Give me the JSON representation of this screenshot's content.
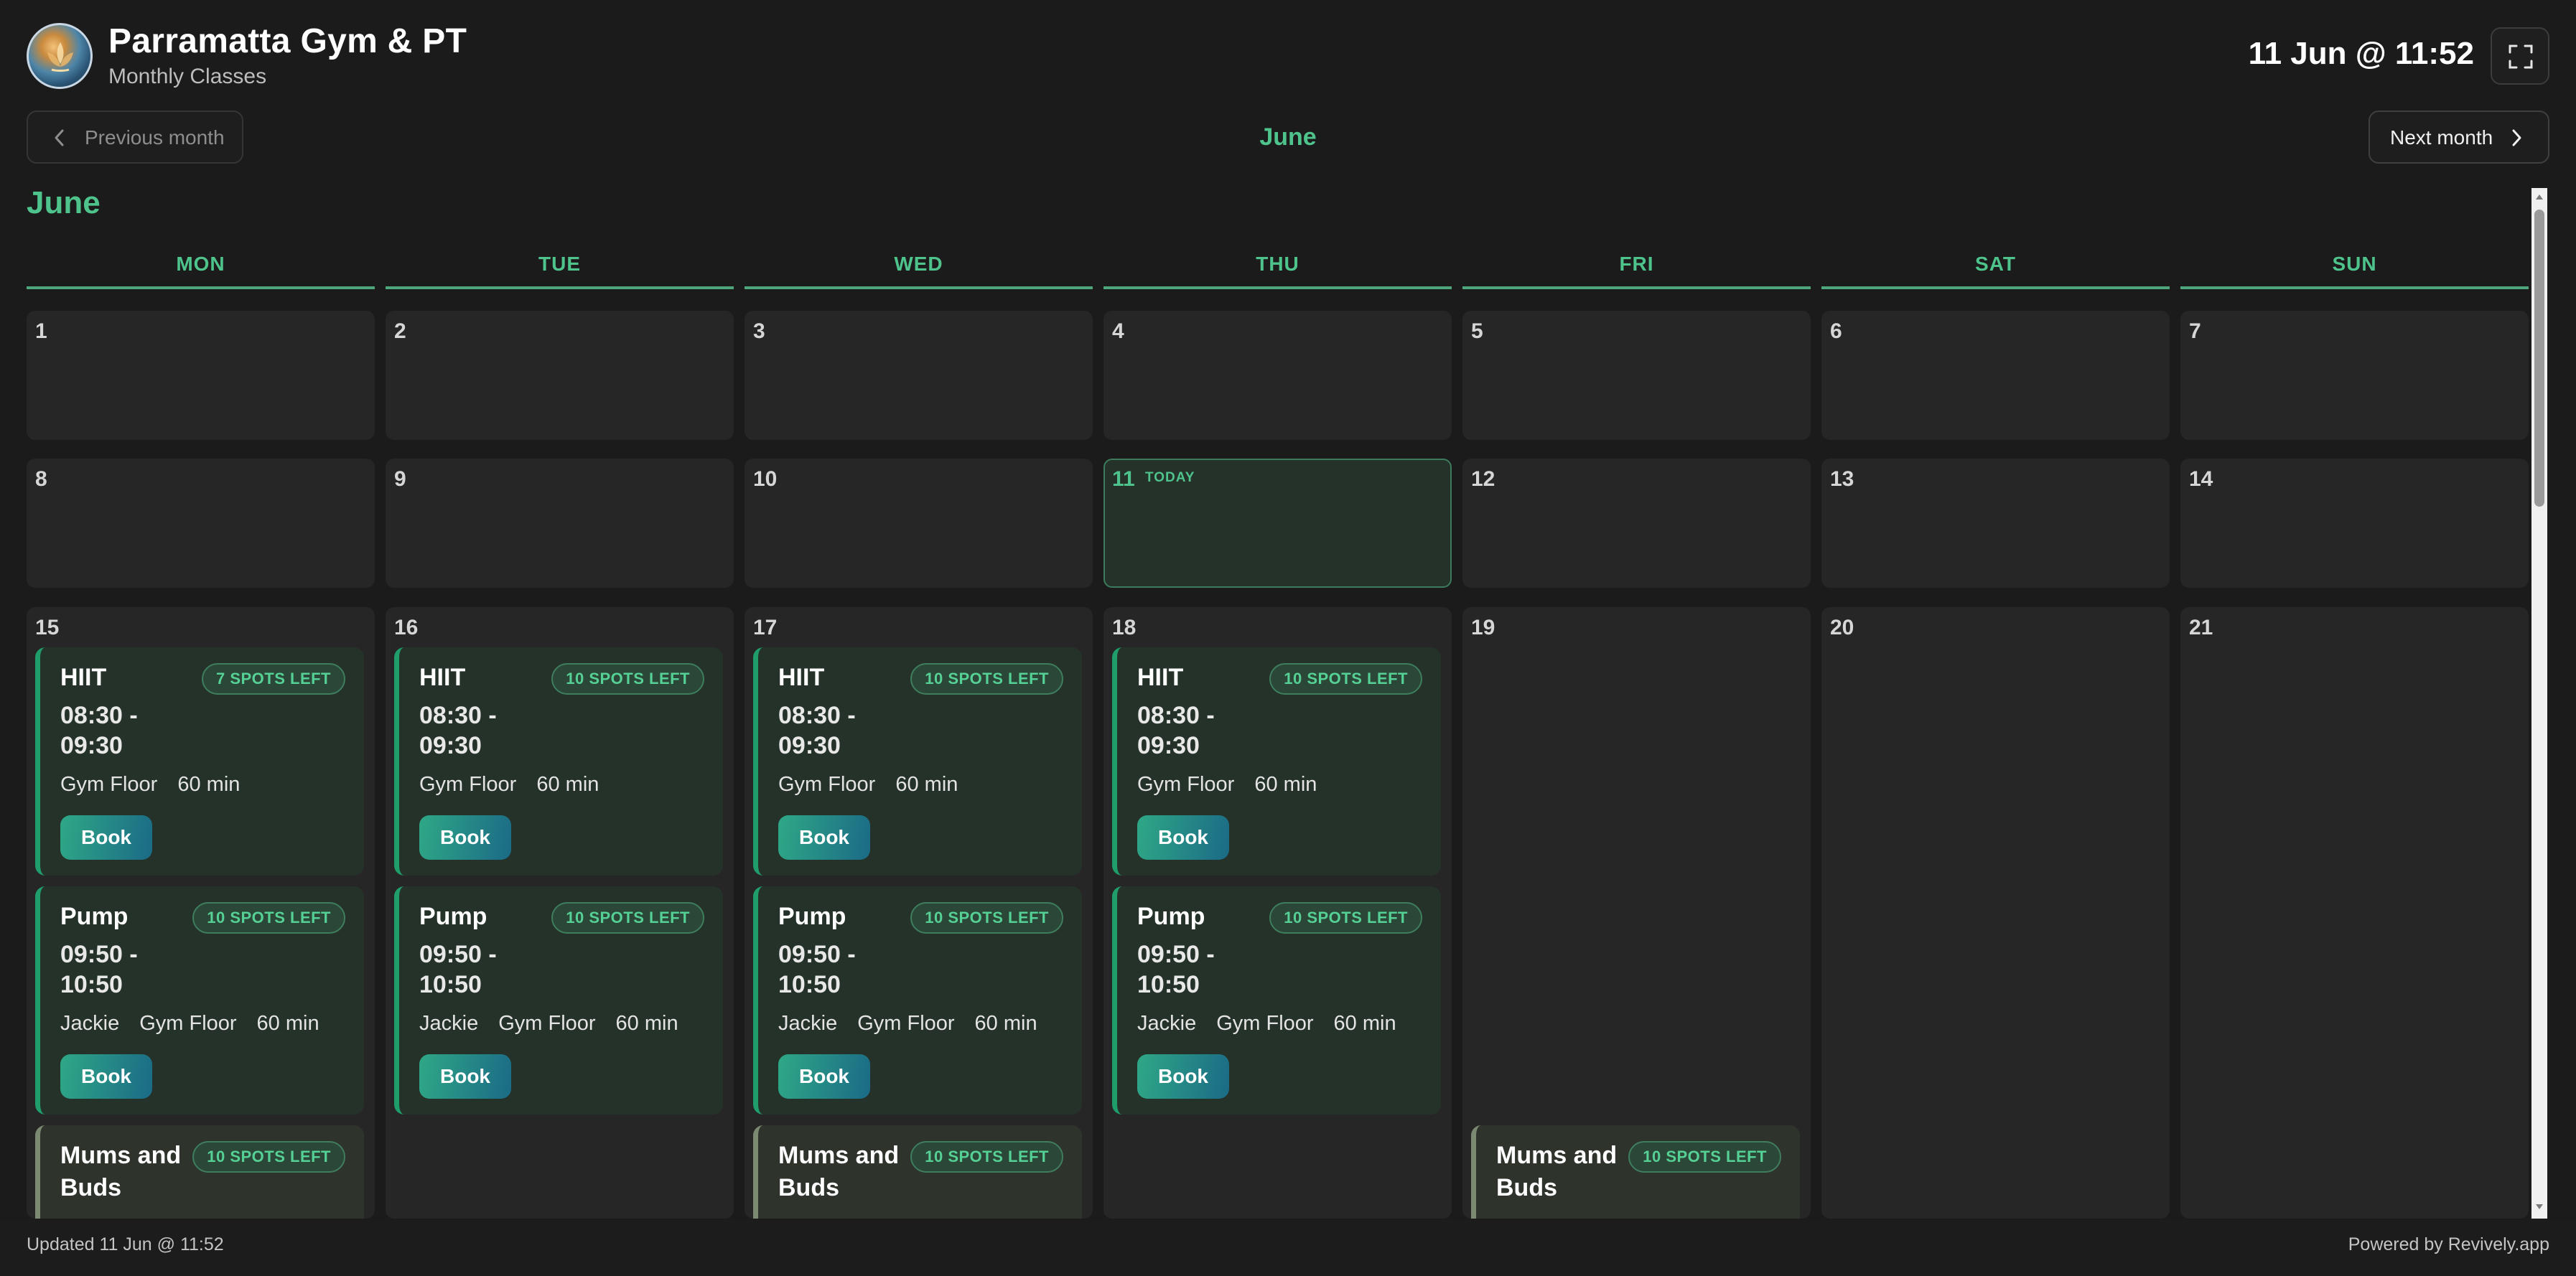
{
  "header": {
    "title": "Parramatta Gym & PT",
    "subtitle": "Monthly Classes",
    "clock": "11 Jun @ 11:52",
    "logo_icon": "gym-logo",
    "fullscreen_icon": "fullscreen-icon"
  },
  "nav": {
    "prev_label": "Previous month",
    "next_label": "Next month",
    "current_month": "June"
  },
  "calendar": {
    "month_heading": "June",
    "weekdays": [
      "MON",
      "TUE",
      "WED",
      "THU",
      "FRI",
      "SAT",
      "SUN"
    ],
    "today_label": "TODAY",
    "weeks": [
      [
        "1",
        "2",
        "3",
        "4",
        "5",
        "6",
        "7"
      ],
      [
        "8",
        "9",
        "10",
        "11",
        "12",
        "13",
        "14"
      ],
      [
        "15",
        "16",
        "17",
        "18",
        "19",
        "20",
        "21"
      ]
    ]
  },
  "classes": {
    "hiit": {
      "name": "HIIT",
      "time": "08:30 - 09:30",
      "location": "Gym Floor",
      "duration": "60 min"
    },
    "pump": {
      "name": "Pump",
      "time": "09:50 - 10:50",
      "instructor": "Jackie",
      "location": "Gym Floor",
      "duration": "60 min"
    },
    "mums": {
      "name": "Mums and Buds"
    },
    "book_label": "Book",
    "spots_7": "7 SPOTS LEFT",
    "spots_10": "10 SPOTS LEFT"
  },
  "footer": {
    "updated": "Updated 11 Jun @ 11:52",
    "powered": "Powered by Revively.app"
  },
  "colors": {
    "accent": "#4ec38c",
    "background": "#1b1b1b",
    "cell": "#262626",
    "card": "#253229"
  }
}
